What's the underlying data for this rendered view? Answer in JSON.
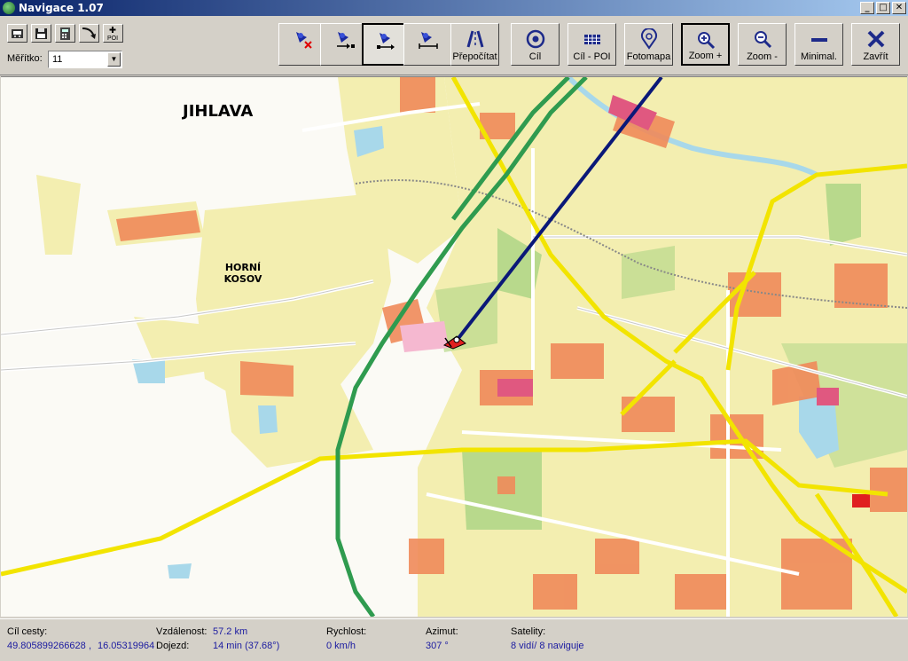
{
  "window": {
    "title": "Navigace 1.07",
    "minimize": "_",
    "maximize": "□",
    "close": "✕"
  },
  "toolbar": {
    "scale_label": "Měřítko:",
    "scale_value": "11",
    "small_buttons": [
      {
        "icon": "gps-receiver-icon"
      },
      {
        "icon": "save-icon"
      },
      {
        "icon": "calculator-icon"
      },
      {
        "icon": "route-icon"
      },
      {
        "icon": "add-poi-icon",
        "label": "POI"
      }
    ],
    "buttons": [
      {
        "icon": "remove-waypoint-icon",
        "label": ""
      },
      {
        "icon": "waypoint-forward-icon",
        "label": ""
      },
      {
        "icon": "waypoint-route-icon",
        "label": ""
      },
      {
        "icon": "waypoint-end-icon",
        "label": ""
      },
      {
        "icon": "recalculate-road-icon",
        "label": "Přepočítat"
      },
      {
        "icon": "target-icon",
        "label": "Cíl"
      },
      {
        "icon": "poi-grid-icon",
        "label": "Cíl - POI"
      },
      {
        "icon": "photo-map-icon",
        "label": "Fotomapa"
      },
      {
        "icon": "zoom-in-icon",
        "label": "Zoom +"
      },
      {
        "icon": "zoom-out-icon",
        "label": "Zoom -"
      },
      {
        "icon": "minimize-icon",
        "label": "Minimal."
      },
      {
        "icon": "close-x-icon",
        "label": "Zavřít"
      }
    ]
  },
  "map": {
    "city_label": "JIHLAVA",
    "district_label_1": "HORNÍ",
    "district_label_2": "KOSOV",
    "colors": {
      "background": "#fbfaf5",
      "road": "#f2e400",
      "highway": "#2f9b4f",
      "route": "#0a1878",
      "buildings": "#f08a5a",
      "vegetation": "#f3eeb0",
      "water": "#a8d8ea"
    }
  },
  "status": {
    "target_label": "Cíl cesty:",
    "lat": "49.805899266628",
    "sep": ",",
    "lon": "16.05319964",
    "distance_label": "Vzdálenost:",
    "distance": "57.2 km",
    "eta_label": "Dojezd:",
    "eta": "14 min (37.68°)",
    "speed_label": "Rychlost:",
    "speed": "0 km/h",
    "azimuth_label": "Azimut:",
    "azimuth": "307 °",
    "satellites_label": "Satelity:",
    "satellites": "8 vidí/ 8 naviguje"
  }
}
